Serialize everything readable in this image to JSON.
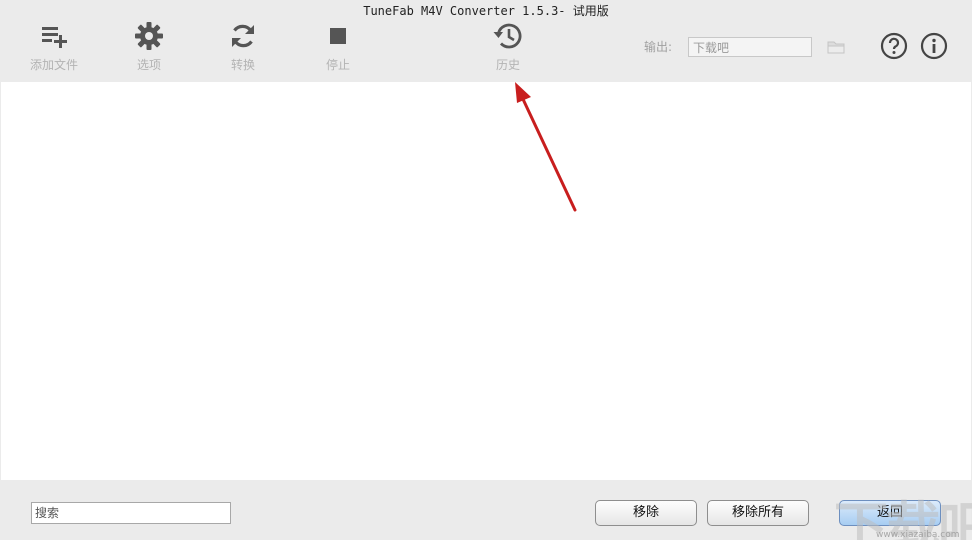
{
  "window": {
    "title": "TuneFab M4V Converter 1.5.3- 试用版"
  },
  "toolbar": {
    "add_files": "添加文件",
    "options": "选项",
    "convert": "转换",
    "stop": "停止",
    "history": "历史"
  },
  "output": {
    "label": "输出:",
    "path": "下载吧"
  },
  "footer": {
    "search_placeholder": "搜索",
    "remove": "移除",
    "remove_all": "移除所有",
    "back": "返回"
  },
  "watermark": {
    "text": "下载吧",
    "url": "www.xiazaiba.com"
  },
  "colors": {
    "toolbar_bg": "#ebebeb",
    "icon_gray": "#555555",
    "label_gray": "#b3b3b3",
    "annotation_arrow": "#c81e1e",
    "primary_button": "#a7cdf2"
  }
}
